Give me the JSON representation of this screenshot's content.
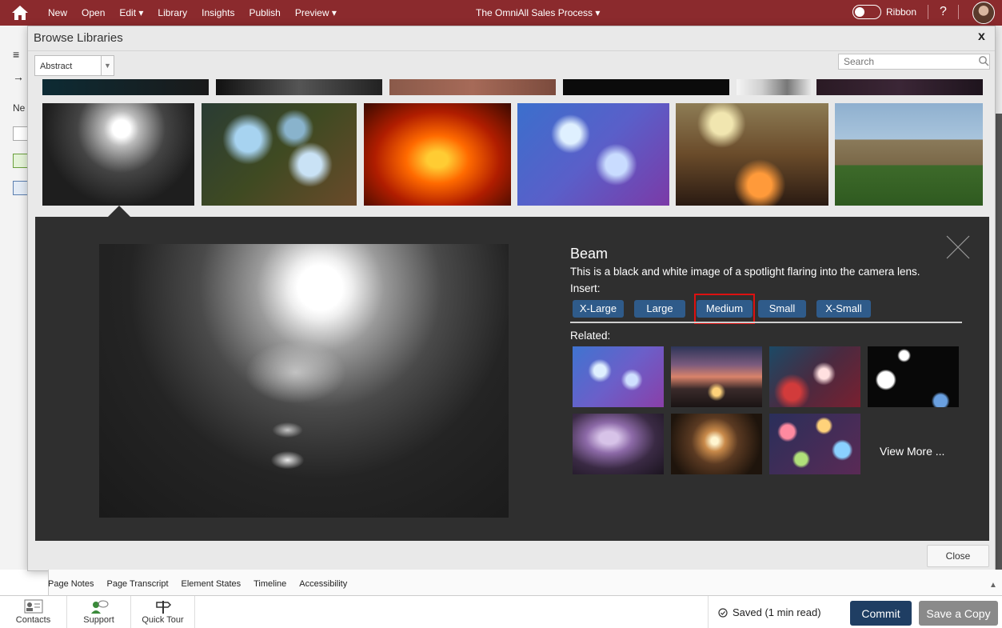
{
  "topbar": {
    "menu": [
      {
        "label": "New"
      },
      {
        "label": "Open"
      },
      {
        "label": "Edit ▾"
      },
      {
        "label": "Library"
      },
      {
        "label": "Insights"
      },
      {
        "label": "Publish"
      },
      {
        "label": "Preview ▾"
      }
    ],
    "doc_title": "The OmniAll Sales Process ▾",
    "ribbon_label": "Ribbon",
    "help_label": "?"
  },
  "background": {
    "left_label": "Ne"
  },
  "modal": {
    "title": "Browse Libraries",
    "close_x": "x",
    "library_select": "Abstract",
    "search_placeholder": "Search",
    "close_button": "Close"
  },
  "detail": {
    "title": "Beam",
    "description": "This is a black and white image of a spotlight flaring into the camera lens.",
    "insert_label": "Insert:",
    "insert_buttons": [
      {
        "label": "X-Large"
      },
      {
        "label": "Large"
      },
      {
        "label": "Medium"
      },
      {
        "label": "Small"
      },
      {
        "label": "X-Small"
      }
    ],
    "related_label": "Related:",
    "view_more": "View More ..."
  },
  "bottom_tabs": [
    {
      "label": "Page Notes"
    },
    {
      "label": "Page Transcript"
    },
    {
      "label": "Element States"
    },
    {
      "label": "Timeline"
    },
    {
      "label": "Accessibility"
    }
  ],
  "bottombar": {
    "contacts": "Contacts",
    "support": "Support",
    "quick_tour": "Quick Tour",
    "saved_status": "Saved (1 min read)",
    "commit": "Commit",
    "save_copy": "Save a Copy"
  },
  "colors": {
    "topbar": "#8b2a2d",
    "insert_button": "#2f5b8a",
    "commit_button": "#1f3e63",
    "save_copy_button": "#8a8a8a",
    "highlight": "#dd1111"
  }
}
